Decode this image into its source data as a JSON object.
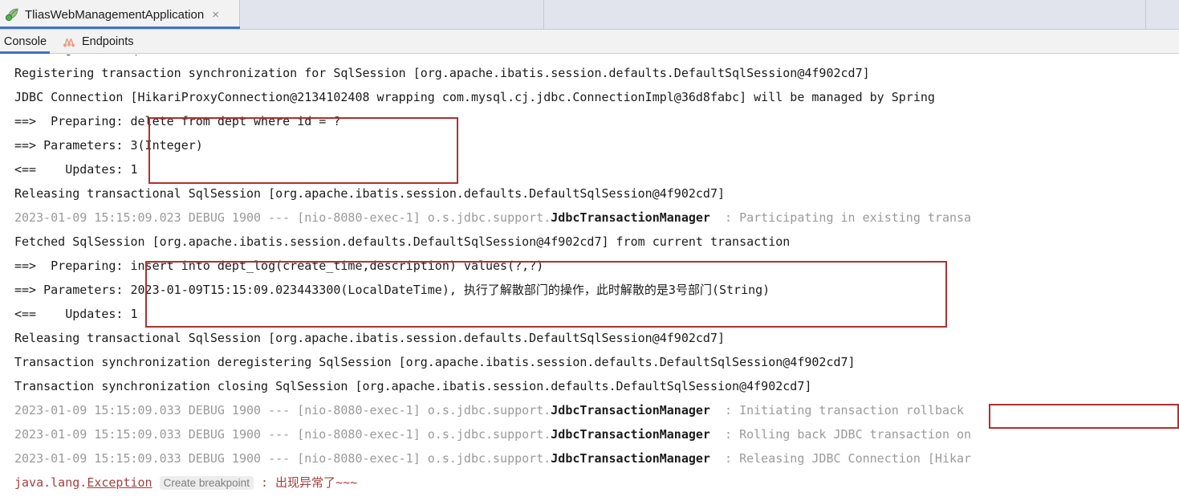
{
  "window": {
    "run_tab": {
      "title": "TliasWebManagementApplication",
      "icon": "spring-boot-run-icon",
      "close_label": "×"
    },
    "empty_tab_slots": 3
  },
  "subtabs": [
    {
      "label": "Console",
      "icon": "console-icon",
      "active": true
    },
    {
      "label": "Endpoints",
      "icon": "endpoints-graph-icon",
      "active": false
    }
  ],
  "colors": {
    "accent_blue": "#3f74bf",
    "tabbar_bg": "#e1e4ed",
    "panel_bg": "#f2f2f3",
    "console_bg": "#ffffff",
    "text_dark": "#1b1b1d",
    "text_gray": "#9a9a9a",
    "error_red": "#a33f3f",
    "annotation_red": "#b03030"
  },
  "annotations": [
    {
      "name": "delete-statement-box",
      "color": "#b03030"
    },
    {
      "name": "insert-deptlog-statement-box",
      "color": "#b03030"
    },
    {
      "name": "transaction-rollback-box",
      "color": "#b03030"
    }
  ],
  "console": {
    "lines": [
      {
        "id": "line-creating-session",
        "clipped": true,
        "spans": [
          {
            "text": "Creating a new SqlSession",
            "style": "dark"
          }
        ]
      },
      {
        "id": "line-registering-sync",
        "spans": [
          {
            "text": "Registering transaction synchronization for SqlSession [org.apache.ibatis.session.defaults.DefaultSqlSession@4f902cd7]",
            "style": "dark"
          }
        ]
      },
      {
        "id": "line-jdbc-connection",
        "spans": [
          {
            "text": "JDBC Connection [HikariProxyConnection@2134102408 wrapping com.mysql.cj.jdbc.ConnectionImpl@36d8fabc] will be managed by Spring",
            "style": "dark"
          }
        ]
      },
      {
        "id": "line-preparing-delete",
        "spans": [
          {
            "text": "==>  Preparing: delete from dept where id = ?",
            "style": "dark"
          }
        ]
      },
      {
        "id": "line-parameters-delete",
        "spans": [
          {
            "text": "==> Parameters: 3(Integer)",
            "style": "dark"
          }
        ]
      },
      {
        "id": "line-updates-delete",
        "spans": [
          {
            "text": "<==    Updates: 1",
            "style": "dark"
          }
        ]
      },
      {
        "id": "line-releasing-1",
        "spans": [
          {
            "text": "Releasing transactional SqlSession [org.apache.ibatis.session.defaults.DefaultSqlSession@4f902cd7]",
            "style": "dark"
          }
        ]
      },
      {
        "id": "line-debug-participating",
        "spans": [
          {
            "text": "2023-01-09 15:15:09.023 DEBUG 1900 --- [nio-8080-exec-1] o.s.jdbc.support.",
            "style": "gray"
          },
          {
            "text": "JdbcTransactionManager",
            "style": "logger"
          },
          {
            "text": "  : Participating in existing transa",
            "style": "gray"
          }
        ]
      },
      {
        "id": "line-fetched-session",
        "spans": [
          {
            "text": "Fetched SqlSession [org.apache.ibatis.session.defaults.DefaultSqlSession@4f902cd7] from current transaction",
            "style": "dark"
          }
        ]
      },
      {
        "id": "line-preparing-insert",
        "spans": [
          {
            "text": "==>  Preparing: insert into dept_log(create_time,description) values(?,?)",
            "style": "dark"
          }
        ]
      },
      {
        "id": "line-parameters-insert",
        "spans": [
          {
            "text": "==> Parameters: 2023-01-09T15:15:09.023443300(LocalDateTime), 执行了解散部门的操作，此时解散的是3号部门(String)",
            "style": "dark"
          }
        ]
      },
      {
        "id": "line-updates-insert",
        "spans": [
          {
            "text": "<==    Updates: 1",
            "style": "dark"
          }
        ]
      },
      {
        "id": "line-releasing-2",
        "spans": [
          {
            "text": "Releasing transactional SqlSession [org.apache.ibatis.session.defaults.DefaultSqlSession@4f902cd7]",
            "style": "dark"
          }
        ]
      },
      {
        "id": "line-deregistering",
        "spans": [
          {
            "text": "Transaction synchronization deregistering SqlSession [org.apache.ibatis.session.defaults.DefaultSqlSession@4f902cd7]",
            "style": "dark"
          }
        ]
      },
      {
        "id": "line-closing",
        "spans": [
          {
            "text": "Transaction synchronization closing SqlSession [org.apache.ibatis.session.defaults.DefaultSqlSession@4f902cd7]",
            "style": "dark"
          }
        ]
      },
      {
        "id": "line-debug-initiating-rollback",
        "spans": [
          {
            "text": "2023-01-09 15:15:09.033 DEBUG 1900 --- [nio-8080-exec-1] o.s.jdbc.support.",
            "style": "gray"
          },
          {
            "text": "JdbcTransactionManager",
            "style": "logger"
          },
          {
            "text": "  : Initiating transaction rollback",
            "style": "gray"
          }
        ]
      },
      {
        "id": "line-debug-rolling-back",
        "spans": [
          {
            "text": "2023-01-09 15:15:09.033 DEBUG 1900 --- [nio-8080-exec-1] o.s.jdbc.support.",
            "style": "gray"
          },
          {
            "text": "JdbcTransactionManager",
            "style": "logger"
          },
          {
            "text": "  : Rolling back JDBC transaction on",
            "style": "gray"
          }
        ]
      },
      {
        "id": "line-debug-releasing-conn",
        "spans": [
          {
            "text": "2023-01-09 15:15:09.033 DEBUG 1900 --- [nio-8080-exec-1] o.s.jdbc.support.",
            "style": "gray"
          },
          {
            "text": "JdbcTransactionManager",
            "style": "logger"
          },
          {
            "text": "  : Releasing JDBC Connection [Hikar",
            "style": "gray"
          }
        ]
      },
      {
        "id": "line-exception",
        "spans": [
          {
            "text": "java.lang.",
            "style": "err"
          },
          {
            "text": "Exception",
            "style": "errlink"
          },
          {
            "text": " ",
            "style": "err"
          },
          {
            "text": "Create breakpoint",
            "style": "bp"
          },
          {
            "text": " : 出现异常了~~~",
            "style": "err"
          }
        ]
      }
    ]
  }
}
